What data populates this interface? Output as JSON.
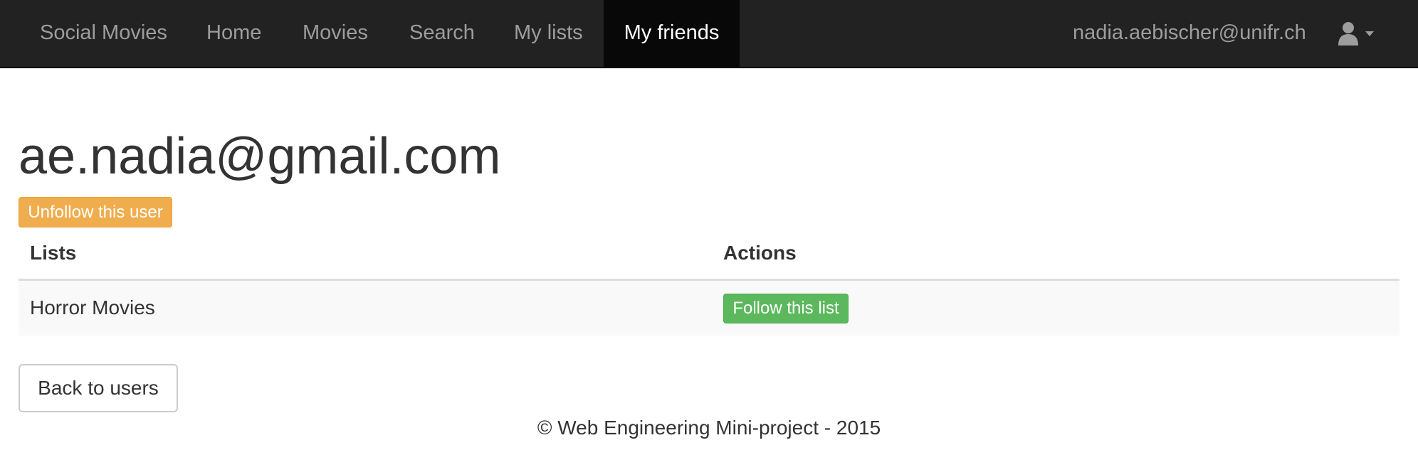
{
  "navbar": {
    "brand": "Social Movies",
    "items": [
      {
        "label": "Home"
      },
      {
        "label": "Movies"
      },
      {
        "label": "Search"
      },
      {
        "label": "My lists"
      },
      {
        "label": "My friends",
        "active": true
      }
    ],
    "user_email": "nadia.aebischer@unifr.ch",
    "user_menu_icon": "user-icon",
    "caret_icon": "caret-down-icon"
  },
  "page": {
    "title": "ae.nadia@gmail.com",
    "unfollow_label": "Unfollow this user"
  },
  "table": {
    "headers": [
      "Lists",
      "Actions"
    ],
    "rows": [
      {
        "list_name": "Horror Movies",
        "action_label": "Follow this list"
      }
    ]
  },
  "back_label": "Back to users",
  "footer": "© Web Engineering Mini-project - 2015",
  "colors": {
    "navbar_bg": "#222222",
    "active_tab_bg": "#080808",
    "warning": "#f0ad4e",
    "success": "#5cb85c"
  }
}
